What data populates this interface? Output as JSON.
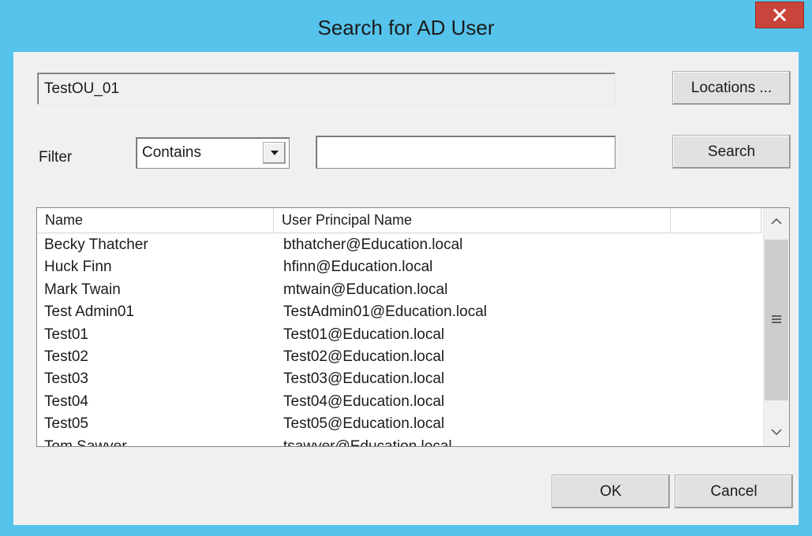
{
  "window": {
    "title": "Search for AD User",
    "close_icon": "close-icon"
  },
  "location": {
    "value": "TestOU_01",
    "button_label": "Locations ..."
  },
  "filter": {
    "label": "Filter",
    "mode": "Contains",
    "text": "",
    "search_label": "Search"
  },
  "results": {
    "columns": [
      "Name",
      "User Principal Name",
      ""
    ],
    "rows": [
      {
        "name": "Becky Thatcher",
        "upn": "bthatcher@Education.local"
      },
      {
        "name": "Huck Finn",
        "upn": "hfinn@Education.local"
      },
      {
        "name": "Mark Twain",
        "upn": "mtwain@Education.local"
      },
      {
        "name": "Test Admin01",
        "upn": "TestAdmin01@Education.local"
      },
      {
        "name": "Test01",
        "upn": "Test01@Education.local"
      },
      {
        "name": "Test02",
        "upn": "Test02@Education.local"
      },
      {
        "name": "Test03",
        "upn": "Test03@Education.local"
      },
      {
        "name": "Test04",
        "upn": "Test04@Education.local"
      },
      {
        "name": "Test05",
        "upn": "Test05@Education.local"
      },
      {
        "name": "Tom Sawyer",
        "upn": "tsawyer@Education.local"
      }
    ]
  },
  "footer": {
    "ok_label": "OK",
    "cancel_label": "Cancel"
  },
  "colors": {
    "frame": "#56c3ec",
    "close": "#c9443b",
    "client": "#f0f0f0"
  }
}
